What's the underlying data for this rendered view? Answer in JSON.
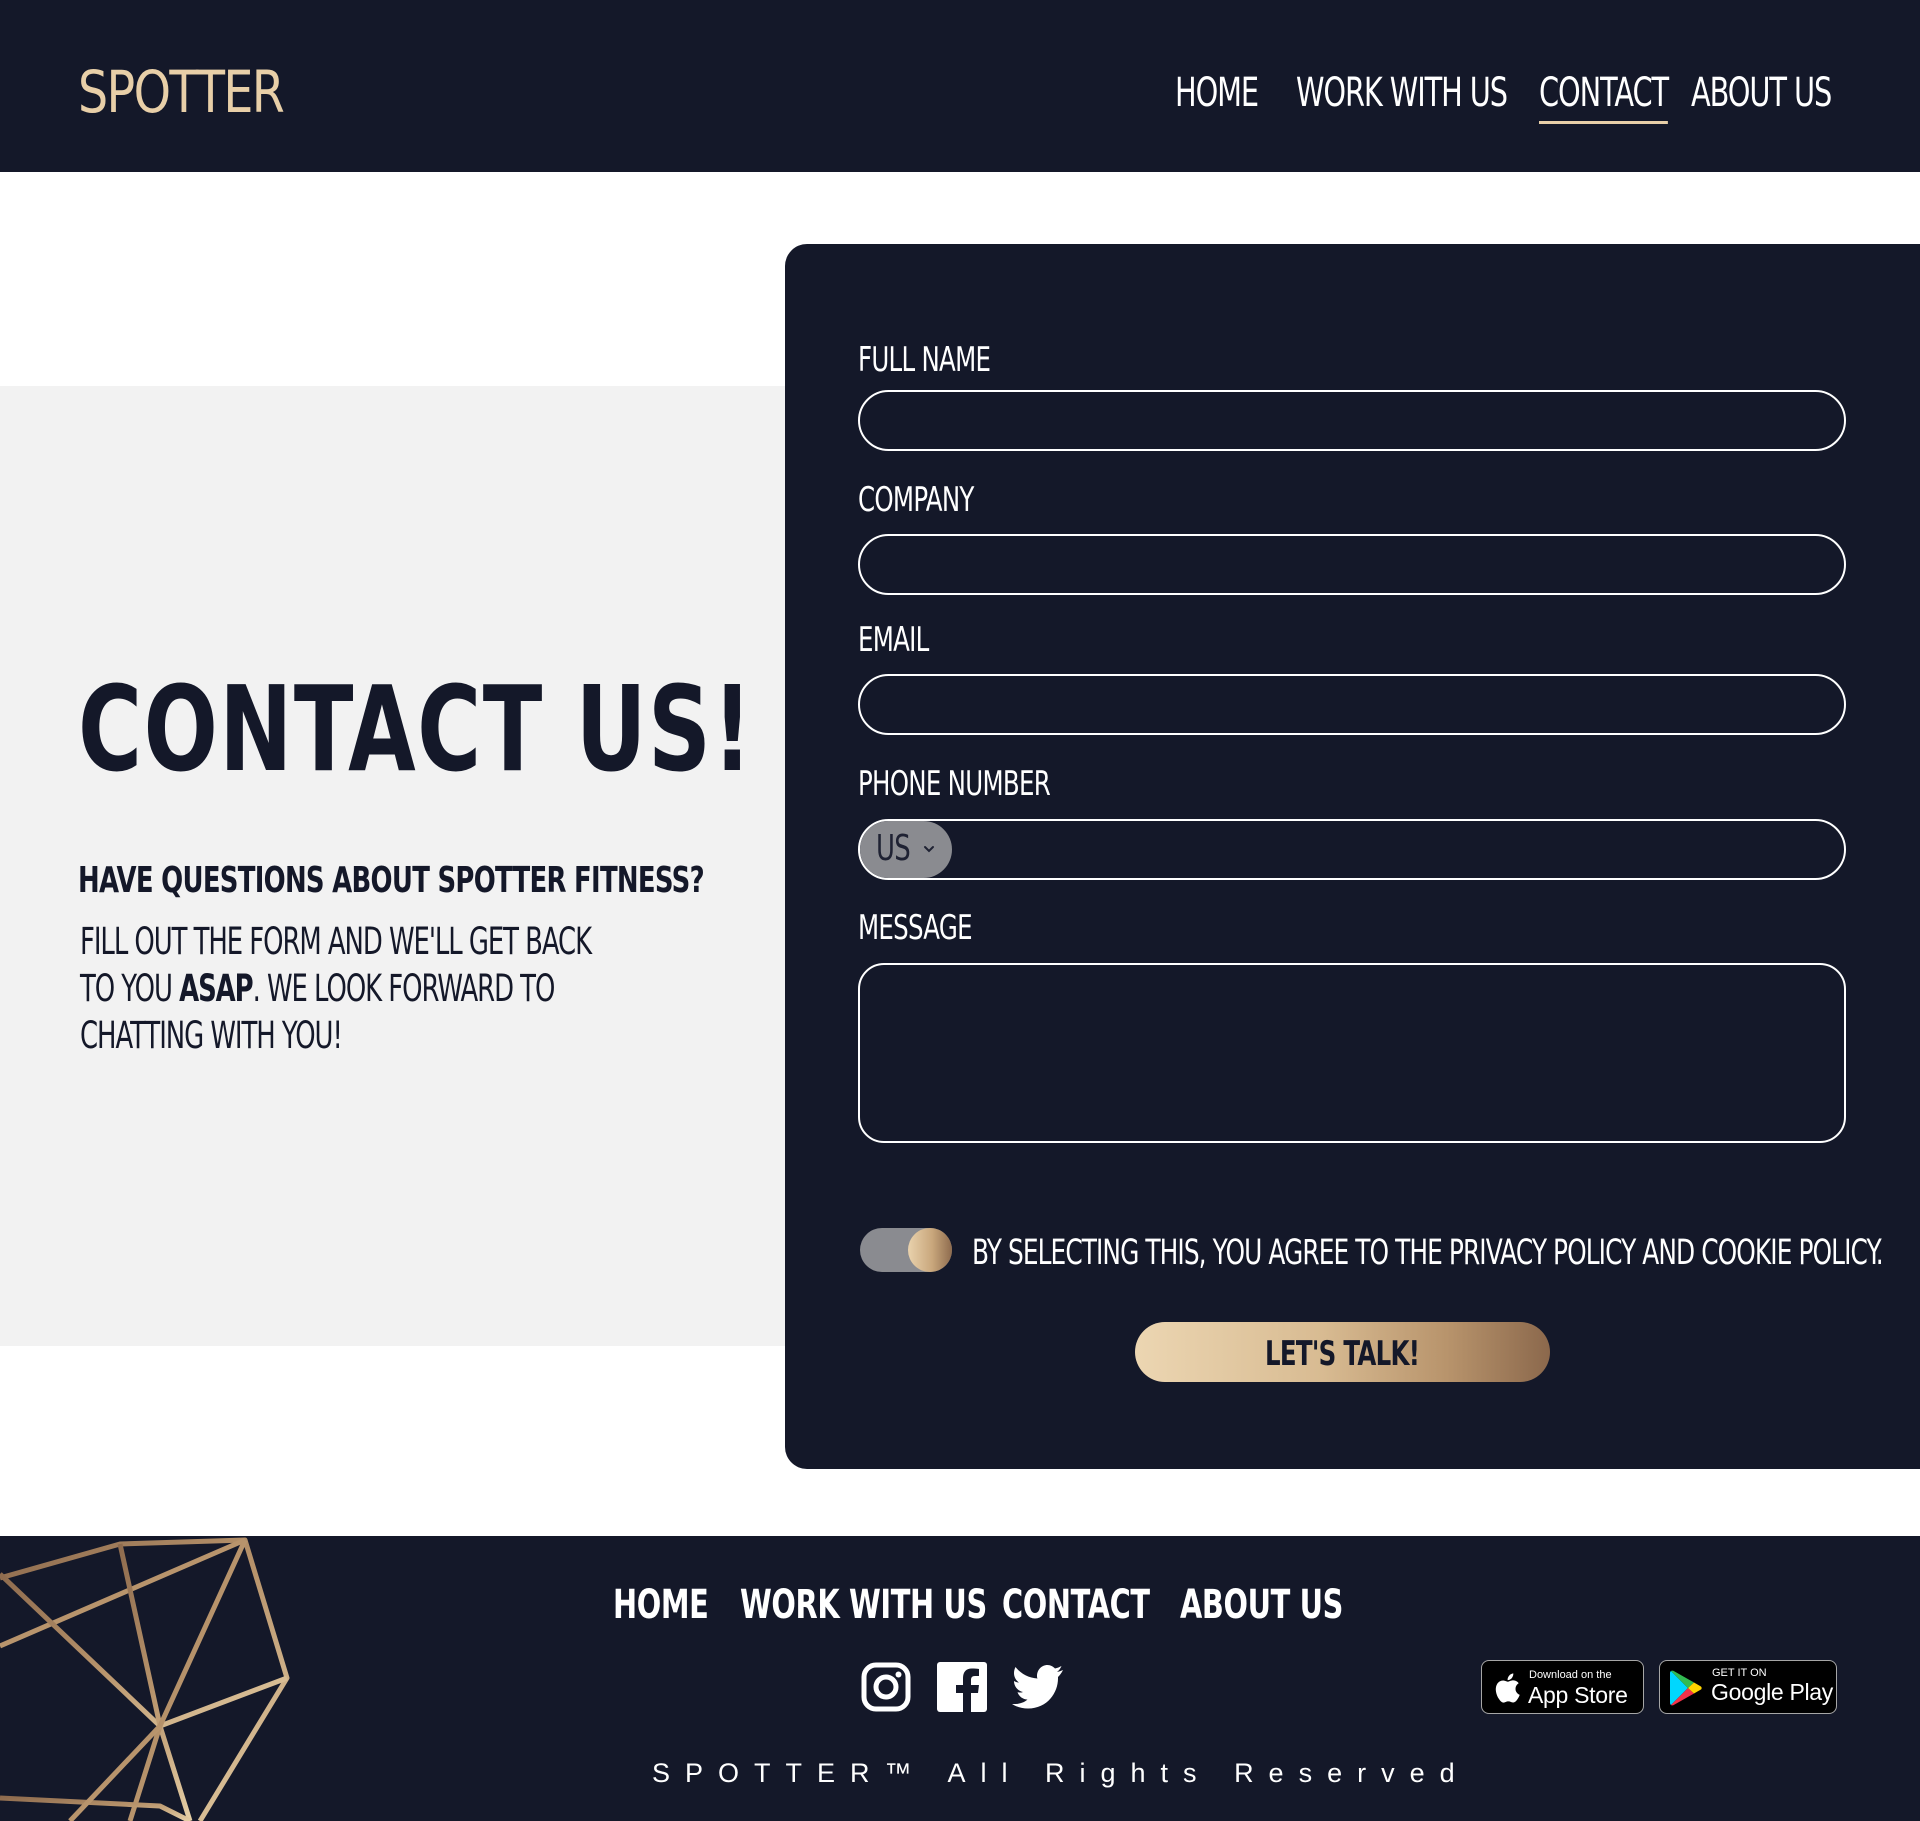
{
  "header": {
    "logo": "SPOTTER",
    "nav": [
      {
        "label": "HOME"
      },
      {
        "label": "WORK WITH US"
      },
      {
        "label": "CONTACT",
        "active": true
      },
      {
        "label": "ABOUT US"
      }
    ]
  },
  "hero": {
    "title": "CONTACT US!",
    "subtitle": "HAVE QUESTIONS ABOUT SPOTTER FITNESS?",
    "intro_part1": "FILL OUT THE FORM AND WE'LL GET BACK TO YOU ",
    "intro_bold": "ASAP",
    "intro_part2": ". WE LOOK FORWARD TO CHATTING WITH YOU!"
  },
  "form": {
    "full_name_label": "FULL NAME",
    "full_name_value": "",
    "company_label": "COMPANY",
    "company_value": "",
    "email_label": "EMAIL",
    "email_value": "",
    "phone_label": "PHONE NUMBER",
    "phone_country": "US",
    "phone_value": "",
    "message_label": "MESSAGE",
    "message_value": "",
    "consent_text": "BY SELECTING THIS, YOU AGREE TO THE PRIVACY POLICY AND COOKIE POLICY.",
    "consent_checked": true,
    "submit_label": "LET'S TALK!"
  },
  "footer": {
    "nav": [
      {
        "label": "HOME"
      },
      {
        "label": "WORK WITH US"
      },
      {
        "label": "CONTACT"
      },
      {
        "label": "ABOUT US"
      }
    ],
    "social_icons": [
      "instagram-icon",
      "facebook-icon",
      "twitter-icon"
    ],
    "app_store": {
      "small": "Download on the",
      "big": "App Store"
    },
    "google_play": {
      "small": "GET IT ON",
      "big": "Google Play"
    },
    "copyright": "SPOTTER™ All Rights Reserved"
  },
  "colors": {
    "navy": "#141829",
    "gold": "#e8cfa8",
    "panel_grey": "#f2f2f2",
    "toggle_grey": "#8a8b90",
    "white": "#ffffff"
  }
}
